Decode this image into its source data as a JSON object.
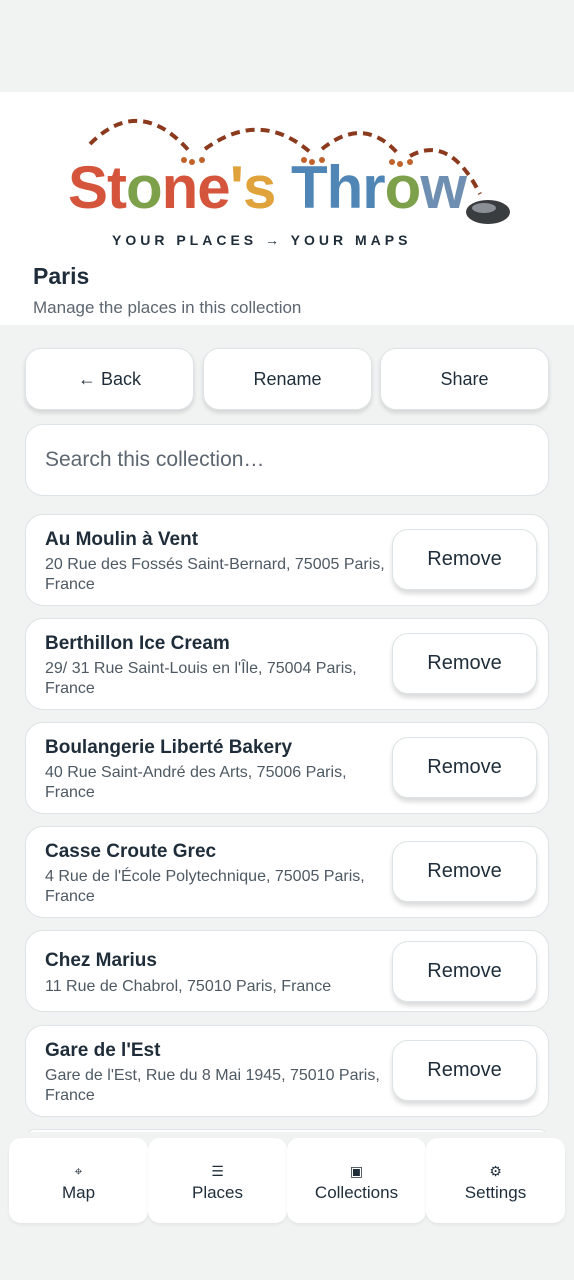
{
  "app": {
    "logo_text": "Stone's Throw",
    "tagline": "YOUR PLACES → YOUR MAPS"
  },
  "header": {
    "title": "Paris",
    "subtitle": "Manage the places in this collection"
  },
  "actions": {
    "back_label": "← Back",
    "rename_label": "Rename",
    "share_label": "Share"
  },
  "search": {
    "placeholder": "Search this collection…"
  },
  "places": [
    {
      "name": "Au Moulin à Vent",
      "address": "20 Rue des Fossés Saint-Bernard, 75005 Paris, France",
      "remove_label": "Remove"
    },
    {
      "name": "Berthillon Ice Cream",
      "address": "29/ 31 Rue Saint-Louis en l'Île, 75004 Paris, France",
      "remove_label": "Remove"
    },
    {
      "name": "Boulangerie Liberté Bakery",
      "address": "40 Rue Saint-André des Arts, 75006 Paris, France",
      "remove_label": "Remove"
    },
    {
      "name": "Casse Croute Grec",
      "address": "4 Rue de l'École Polytechnique, 75005 Paris, France",
      "remove_label": "Remove"
    },
    {
      "name": "Chez Marius",
      "address": "11 Rue de Chabrol, 75010 Paris, France",
      "remove_label": "Remove"
    },
    {
      "name": "Gare de l'Est",
      "address": "Gare de l'Est, Rue du 8 Mai 1945, 75010 Paris, France",
      "remove_label": "Remove"
    }
  ],
  "nav": {
    "map": {
      "label": "Map",
      "icon": "crosshair-icon",
      "glyph": "⌖"
    },
    "places": {
      "label": "Places",
      "icon": "list-icon",
      "glyph": "☰"
    },
    "collections": {
      "label": "Collections",
      "icon": "collection-square-icon",
      "glyph": "▣"
    },
    "settings": {
      "label": "Settings",
      "icon": "gear-icon",
      "glyph": "⚙"
    }
  }
}
